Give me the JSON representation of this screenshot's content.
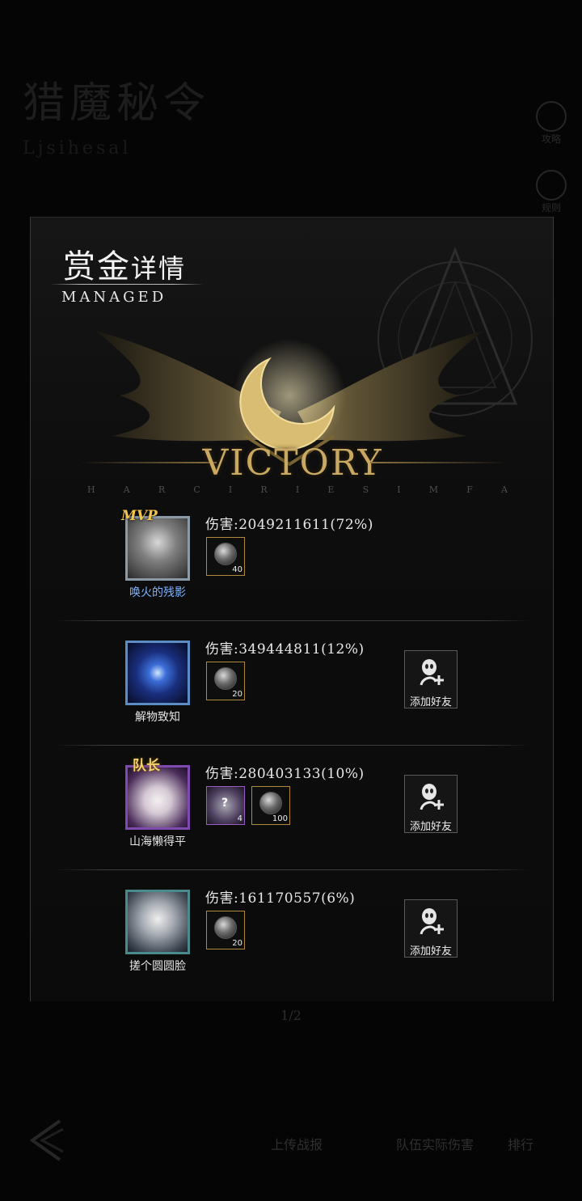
{
  "background": {
    "title_cn": "猎魔秘令",
    "title_sub": "Ljsihesal",
    "side_buttons": [
      "攻略",
      "规则"
    ],
    "footer": {
      "btn1": "上传战报",
      "btn2": "队伍实际伤害",
      "btn3": "排行"
    },
    "pager": "1/2"
  },
  "panel": {
    "title_big": "赏金",
    "title_small": "详情",
    "subtitle": "MANAGED",
    "victory": "VICTORY",
    "letters": [
      "H",
      "A",
      "R",
      "C",
      "I",
      "R",
      "I",
      "E",
      "S",
      "I",
      "M",
      "F",
      "A"
    ]
  },
  "players": [
    {
      "name": "唤火的残影",
      "damage": "伤害:2049211611(72%)",
      "badge": "MVP",
      "items": [
        {
          "count": "40",
          "type": "orb"
        }
      ],
      "add_friend": null
    },
    {
      "name": "解物致知",
      "damage": "伤害:349444811(12%)",
      "badge": "",
      "items": [
        {
          "count": "20",
          "type": "orb"
        }
      ],
      "add_friend": "添加好友"
    },
    {
      "name": "山海懒得平",
      "damage": "伤害:280403133(10%)",
      "badge": "队长",
      "items": [
        {
          "count": "4",
          "type": "mystery",
          "mark": "?"
        },
        {
          "count": "100",
          "type": "orb"
        }
      ],
      "add_friend": "添加好友"
    },
    {
      "name": "搓个圆圆脸",
      "damage": "伤害:161170557(6%)",
      "badge": "",
      "items": [
        {
          "count": "20",
          "type": "orb"
        }
      ],
      "add_friend": "添加好友"
    }
  ]
}
